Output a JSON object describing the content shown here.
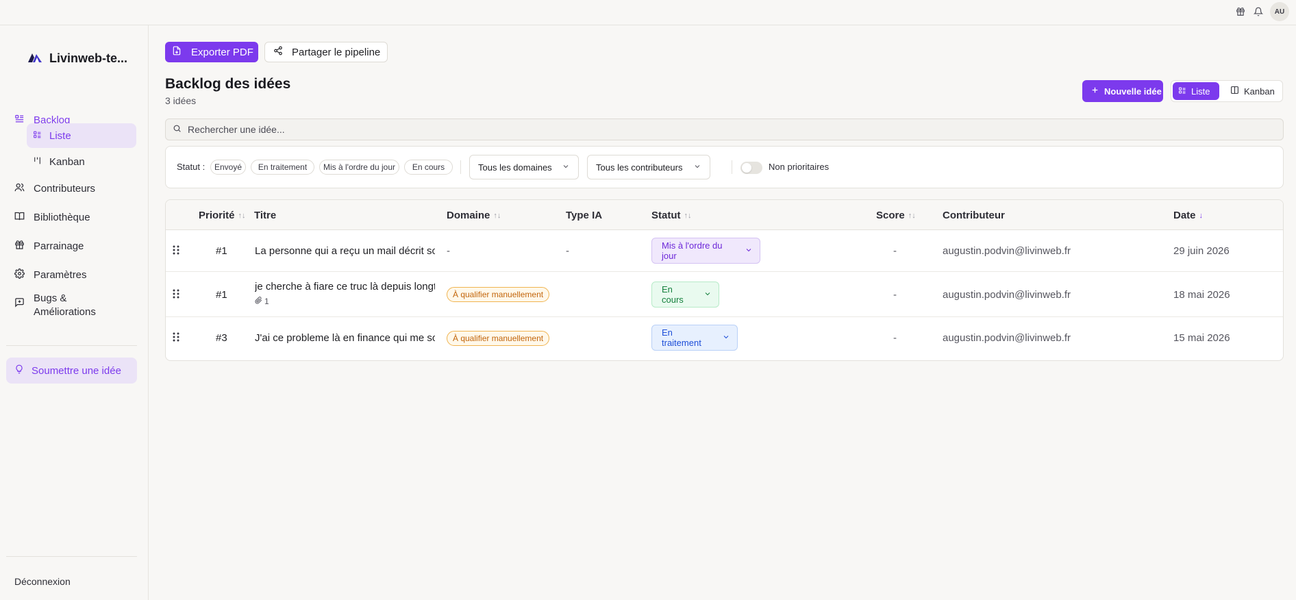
{
  "topbar": {
    "icons": [
      "gift-icon",
      "bell-icon"
    ],
    "avatar": "AU"
  },
  "sidebar": {
    "brand": "Livinweb-te...",
    "nav": [
      {
        "label": "Backlog",
        "icon": "backlog-icon"
      },
      {
        "label": "Liste",
        "icon": "list-icon"
      },
      {
        "label": "Kanban",
        "icon": "kanban-icon"
      },
      {
        "label": "Contributeurs",
        "icon": "users-icon"
      },
      {
        "label": "Bibliothèque",
        "icon": "book-icon"
      },
      {
        "label": "Parrainage",
        "icon": "gift-icon"
      },
      {
        "label": "Paramètres",
        "icon": "gear-icon"
      },
      {
        "label_line1": "Bugs &",
        "label_line2": "Améliorations",
        "icon": "feedback-icon"
      }
    ],
    "submit": "Soumettre une idée",
    "logout": "Déconnexion"
  },
  "toolbar": {
    "export_pdf": "Exporter PDF",
    "share": "Partager le pipeline"
  },
  "page": {
    "title": "Backlog des idées",
    "count": "3 idées"
  },
  "actions": {
    "new_idea": "Nouvelle idée",
    "view_list": "Liste",
    "view_kanban": "Kanban"
  },
  "search": {
    "placeholder": "Rechercher une idée..."
  },
  "filters": {
    "status_label": "Statut :",
    "chips": [
      "Envoyé",
      "En traitement",
      "Mis à l'ordre du jour",
      "En cours"
    ],
    "domain_select": "Tous les domaines",
    "contributor_select": "Tous les contributeurs",
    "non_priority_label": "Non prioritaires"
  },
  "table": {
    "headers": {
      "priority": "Priorité",
      "title": "Titre",
      "domain": "Domaine",
      "type_ia": "Type IA",
      "status": "Statut",
      "score": "Score",
      "contributor": "Contributeur",
      "date": "Date"
    },
    "rows": [
      {
        "priority": "#1",
        "title": "La personne qui a reçu un mail décrit son",
        "domain": "-",
        "type_ia": "-",
        "status": "Mis à l'ordre du jour",
        "score": "-",
        "contributor": "augustin.podvin@livinweb.fr",
        "date": "29 juin 2026"
      },
      {
        "priority": "#1",
        "title": "je cherche à fiare ce truc là depuis longtemps",
        "attachments": "1",
        "domain": "À qualifier manuellement",
        "status": "En cours",
        "score": "-",
        "contributor": "augustin.podvin@livinweb.fr",
        "date": "18 mai 2026"
      },
      {
        "priority": "#3",
        "title": "J'ai ce probleme là en finance qui me soule",
        "domain": "À qualifier manuellement",
        "status": "En traitement",
        "score": "-",
        "contributor": "augustin.podvin@livinweb.fr",
        "date": "15 mai 2026"
      }
    ]
  },
  "colors": {
    "accent": "#7c3aed",
    "badge_orange": "#c2650a",
    "status_green": "#15803d",
    "status_blue": "#1d4ed8"
  }
}
